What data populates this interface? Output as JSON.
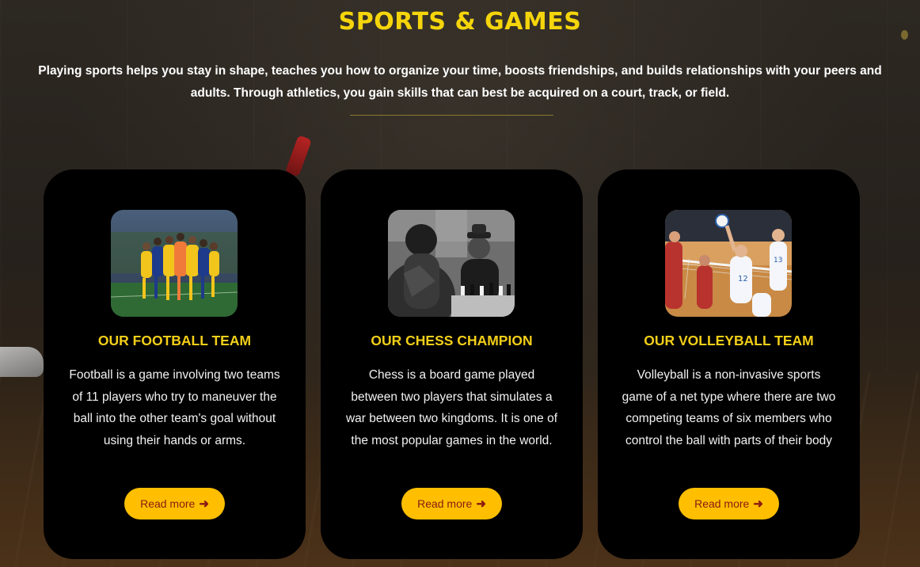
{
  "section": {
    "title": "SPORTS & GAMES",
    "intro": "Playing sports helps you stay in shape, teaches you how to organize your time, boosts friendships, and builds relationships with your peers and adults. Through athletics, you gain skills that can best be acquired on a court, track, or field."
  },
  "cards": [
    {
      "title": "OUR FOOTBALL TEAM",
      "text": "Football is a game involving two teams of 11 players who try to maneuver the ball into the other team's goal without using their hands or arms.",
      "button_label": "Read more",
      "button_icon": "arrow-right-icon"
    },
    {
      "title": "OUR CHESS CHAMPION",
      "text": "Chess is a board game played between two players that simulates a war between two kingdoms. It is one of the most popular games in the world.",
      "button_label": "Read more",
      "button_icon": "arrow-right-icon"
    },
    {
      "title": "OUR VOLLEYBALL TEAM",
      "text": "Volleyball is a non-invasive sports game of a net type where there are two competing teams of six members who control the ball with parts of their body",
      "button_label": "Read more",
      "button_icon": "arrow-right-icon"
    }
  ],
  "colors": {
    "accent": "#f5d50b",
    "button": "#ffbf00",
    "button_text": "#8a1a12",
    "card_bg": "#000000"
  }
}
